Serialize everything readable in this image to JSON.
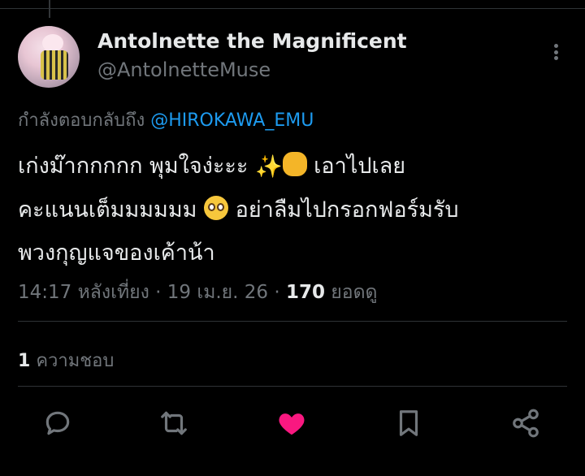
{
  "tweet": {
    "author": {
      "name": "Antolnette the Magnificent",
      "handle": "@AntolnetteMuse"
    },
    "reply_prefix": "กำลังตอบกลับถึง",
    "reply_to": "@HIROKAWA_EMU",
    "text_lines": [
      "เก่งม๊ากกกกก พุมใจง่ะะะ",
      "เอาไปเลย",
      "คะแนนเต็มมมมมม",
      "อย่าลืมไปกรอกฟอร์มรับ",
      "พวงกุญแจของเค้าน้า"
    ],
    "emoji_sparkles": "✨",
    "time": "14:17 หลังเที่ยง",
    "separator": "·",
    "date": "19 เม.ย. 26",
    "views_count": "170",
    "views_label": "ยอดดู",
    "likes_count": "1",
    "likes_label": "ความชอบ"
  },
  "icons": {
    "more": "more-dots-icon",
    "reply": "reply-icon",
    "retweet": "retweet-icon",
    "like": "heart-icon",
    "bookmark": "bookmark-icon",
    "share": "share-icon"
  },
  "colors": {
    "background": "#000000",
    "text": "#e7e9ea",
    "muted": "#71767b",
    "link": "#1d9bf0",
    "liked": "#f91880"
  }
}
